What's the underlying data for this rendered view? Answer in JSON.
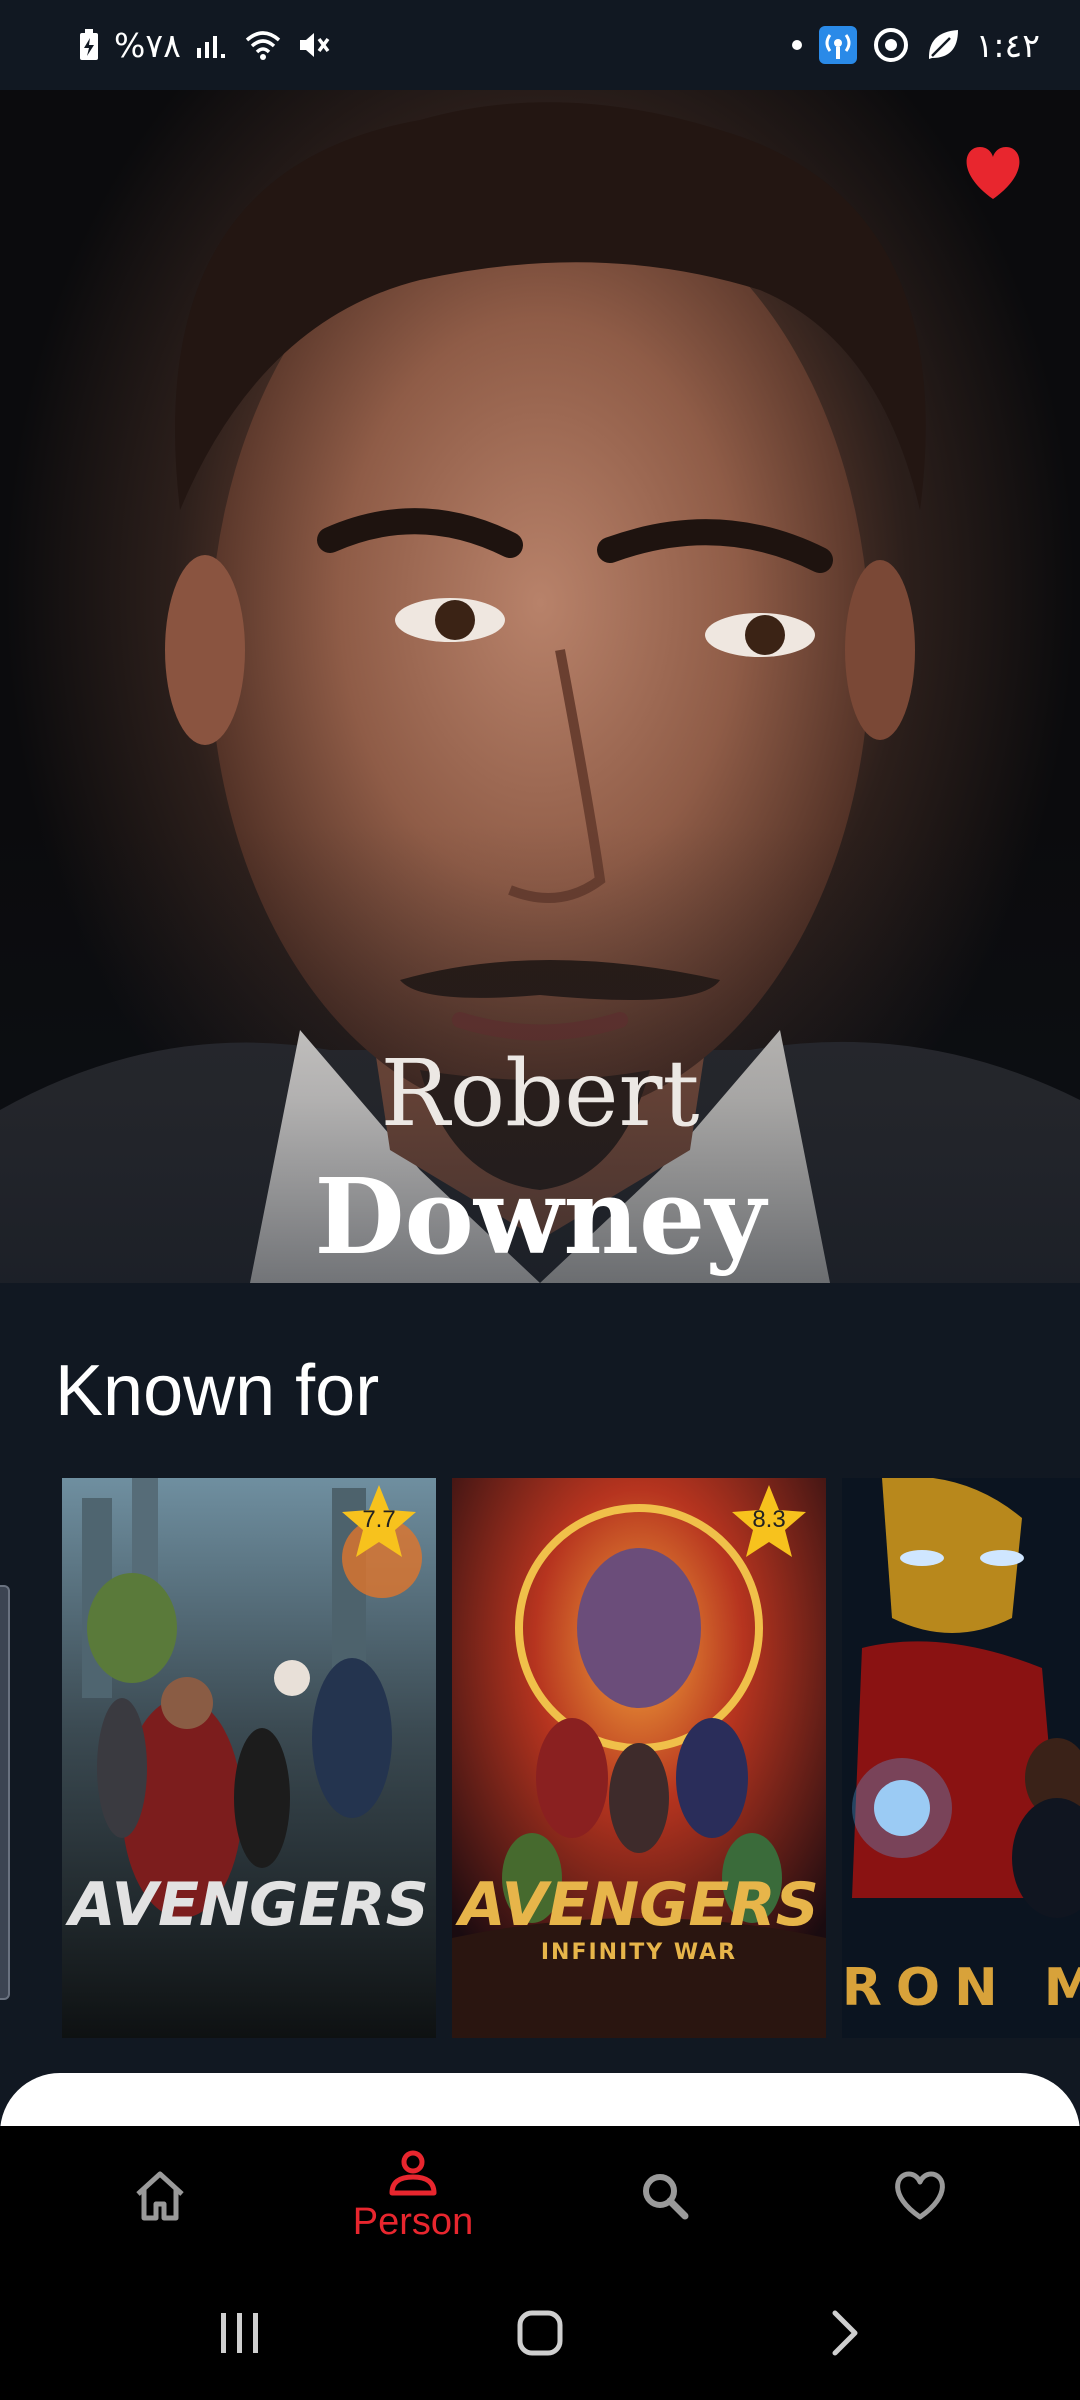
{
  "status_bar": {
    "battery": "%٧٨",
    "time": "١:٤٢",
    "icons": [
      "battery-charging-icon",
      "signal-icon",
      "wifi-icon",
      "mute-icon",
      "dot-icon",
      "hotspot-icon",
      "sync-icon",
      "leaf-icon"
    ]
  },
  "person": {
    "first_name": "Robert",
    "last_name": "Downey",
    "favorite": true
  },
  "known_for": {
    "title": "Known for",
    "movies": [
      {
        "title": "AVENGERS",
        "subtitle": "",
        "rating": "7.7"
      },
      {
        "title": "AVENGERS",
        "subtitle": "INFINITY WAR",
        "rating": "8.3"
      },
      {
        "title": "IRON M",
        "subtitle": "",
        "rating": ""
      }
    ]
  },
  "bottom_nav": {
    "items": [
      {
        "label": "",
        "icon": "home-icon",
        "active": false
      },
      {
        "label": "Person",
        "icon": "person-icon",
        "active": true
      },
      {
        "label": "",
        "icon": "search-icon",
        "active": false
      },
      {
        "label": "",
        "icon": "heart-outline-icon",
        "active": false
      }
    ]
  },
  "colors": {
    "accent": "#e8262e",
    "background": "#111822",
    "star": "#f7c21d"
  }
}
